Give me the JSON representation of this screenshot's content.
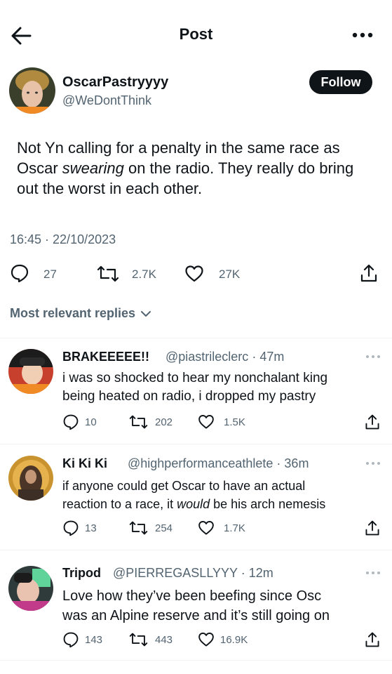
{
  "header": {
    "title": "Post"
  },
  "post": {
    "author_name": "OscarPastryyyy",
    "author_handle": "@WeDontThink",
    "follow_label": "Follow",
    "text_before": "Not Yn calling for a penalty in the same race as Oscar ",
    "text_emph": "swearing",
    "text_after": " on the radio. They really do bring out the worst in each other.",
    "timestamp": "16:45 · 22/10/2023",
    "replies_count": "27",
    "reposts_count": "2.7K",
    "likes_count": "27K"
  },
  "replies_sort": {
    "label": "Most relevant replies"
  },
  "replies": [
    {
      "name": "BRAKEEEEE!!",
      "handle": "@piastrileclerc",
      "time": "· 47m",
      "line1": "i was so shocked to hear my nonchalant king",
      "line2": "being heated on radio, i dropped my pastry",
      "replies": "10",
      "reposts": "202",
      "likes": "1.5K"
    },
    {
      "name": "Ki Ki Ki",
      "handle": "@highperformanceathlete",
      "time": "· 36m",
      "line1": "if anyone could get Oscar to have an actual",
      "line2_before": "reaction to a race, it ",
      "line2_emph": "would",
      "line2_after": " be his arch nemesis",
      "replies": "13",
      "reposts": "254",
      "likes": "1.7K"
    },
    {
      "name": "Tripod",
      "handle": "@PIERREGASLLYYY",
      "time": "· 12m",
      "line1": "Love how they’ve been beefing since Osc",
      "line2": "was an Alpine reserve and it’s still going on",
      "replies": "143",
      "reposts": "443",
      "likes": "16.9K"
    }
  ],
  "icons": {
    "back": "arrow-left-icon",
    "more": "more-horizontal-icon",
    "reply": "reply-bubble-icon",
    "repost": "repost-icon",
    "like": "heart-icon",
    "share": "share-icon",
    "chevron": "chevron-down-icon"
  },
  "colors": {
    "text": "#0f1419",
    "muted": "#536471",
    "follow_bg": "#0f1419"
  }
}
